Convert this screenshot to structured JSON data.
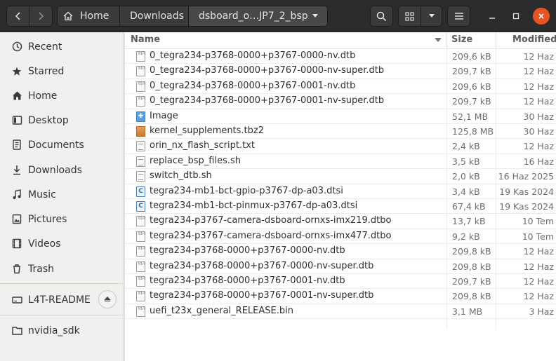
{
  "header": {
    "breadcrumbs": [
      "Home",
      "Downloads",
      "dsboard_o…JP7_2_bsp"
    ]
  },
  "sidebar": {
    "items": [
      {
        "label": "Recent",
        "icon": "clock-icon"
      },
      {
        "label": "Starred",
        "icon": "star-icon"
      },
      {
        "label": "Home",
        "icon": "home-icon"
      },
      {
        "label": "Desktop",
        "icon": "desktop-icon"
      },
      {
        "label": "Documents",
        "icon": "document-icon"
      },
      {
        "label": "Downloads",
        "icon": "download-icon"
      },
      {
        "label": "Music",
        "icon": "music-icon"
      },
      {
        "label": "Pictures",
        "icon": "picture-icon"
      },
      {
        "label": "Videos",
        "icon": "video-icon"
      },
      {
        "label": "Trash",
        "icon": "trash-icon"
      }
    ],
    "devices": [
      {
        "label": "L4T-README",
        "icon": "drive-icon"
      },
      {
        "label": "nvidia_sdk",
        "icon": "folder-icon"
      }
    ]
  },
  "columns": {
    "name": "Name",
    "size": "Size",
    "modified": "Modified"
  },
  "files": [
    {
      "name": "0_tegra234-p3768-0000+p3767-0000-nv.dtb",
      "size": "209,6 kB",
      "modified": "12 Haz",
      "icon": "binary-file-icon"
    },
    {
      "name": "0_tegra234-p3768-0000+p3767-0000-nv-super.dtb",
      "size": "209,7 kB",
      "modified": "12 Haz",
      "icon": "binary-file-icon"
    },
    {
      "name": "0_tegra234-p3768-0000+p3767-0001-nv.dtb",
      "size": "209,6 kB",
      "modified": "12 Haz",
      "icon": "binary-file-icon"
    },
    {
      "name": "0_tegra234-p3768-0000+p3767-0001-nv-super.dtb",
      "size": "209,7 kB",
      "modified": "12 Haz",
      "icon": "binary-file-icon"
    },
    {
      "name": "Image",
      "size": "52,1 MB",
      "modified": "30 Haz",
      "icon": "image-file-icon"
    },
    {
      "name": "kernel_supplements.tbz2",
      "size": "125,8 MB",
      "modified": "30 Haz",
      "icon": "archive-file-icon"
    },
    {
      "name": "orin_nx_flash_script.txt",
      "size": "2,4 kB",
      "modified": "12 Haz",
      "icon": "text-file-icon"
    },
    {
      "name": "replace_bsp_files.sh",
      "size": "3,5 kB",
      "modified": "16 Haz",
      "icon": "text-file-icon"
    },
    {
      "name": "switch_dtb.sh",
      "size": "2,0 kB",
      "modified": "16 Haz 2025",
      "icon": "text-file-icon"
    },
    {
      "name": "tegra234-mb1-bct-gpio-p3767-dp-a03.dtsi",
      "size": "3,4 kB",
      "modified": "19 Kas 2024",
      "icon": "c-source-file-icon"
    },
    {
      "name": "tegra234-mb1-bct-pinmux-p3767-dp-a03.dtsi",
      "size": "67,4 kB",
      "modified": "19 Kas 2024",
      "icon": "c-source-file-icon"
    },
    {
      "name": "tegra234-p3767-camera-dsboard-ornxs-imx219.dtbo",
      "size": "13,7 kB",
      "modified": "10 Tem",
      "icon": "binary-file-icon"
    },
    {
      "name": "tegra234-p3767-camera-dsboard-ornxs-imx477.dtbo",
      "size": "9,2 kB",
      "modified": "10 Tem",
      "icon": "binary-file-icon"
    },
    {
      "name": "tegra234-p3768-0000+p3767-0000-nv.dtb",
      "size": "209,8 kB",
      "modified": "12 Haz",
      "icon": "binary-file-icon"
    },
    {
      "name": "tegra234-p3768-0000+p3767-0000-nv-super.dtb",
      "size": "209,8 kB",
      "modified": "12 Haz",
      "icon": "binary-file-icon"
    },
    {
      "name": "tegra234-p3768-0000+p3767-0001-nv.dtb",
      "size": "209,7 kB",
      "modified": "12 Haz",
      "icon": "binary-file-icon"
    },
    {
      "name": "tegra234-p3768-0000+p3767-0001-nv-super.dtb",
      "size": "209,8 kB",
      "modified": "12 Haz",
      "icon": "binary-file-icon"
    },
    {
      "name": "uefi_t23x_general_RELEASE.bin",
      "size": "3,1 MB",
      "modified": "3 Haz",
      "icon": "binary-file-icon"
    }
  ],
  "colors": {
    "accent": "#e95420",
    "headerbar": "#2c2c2c"
  }
}
